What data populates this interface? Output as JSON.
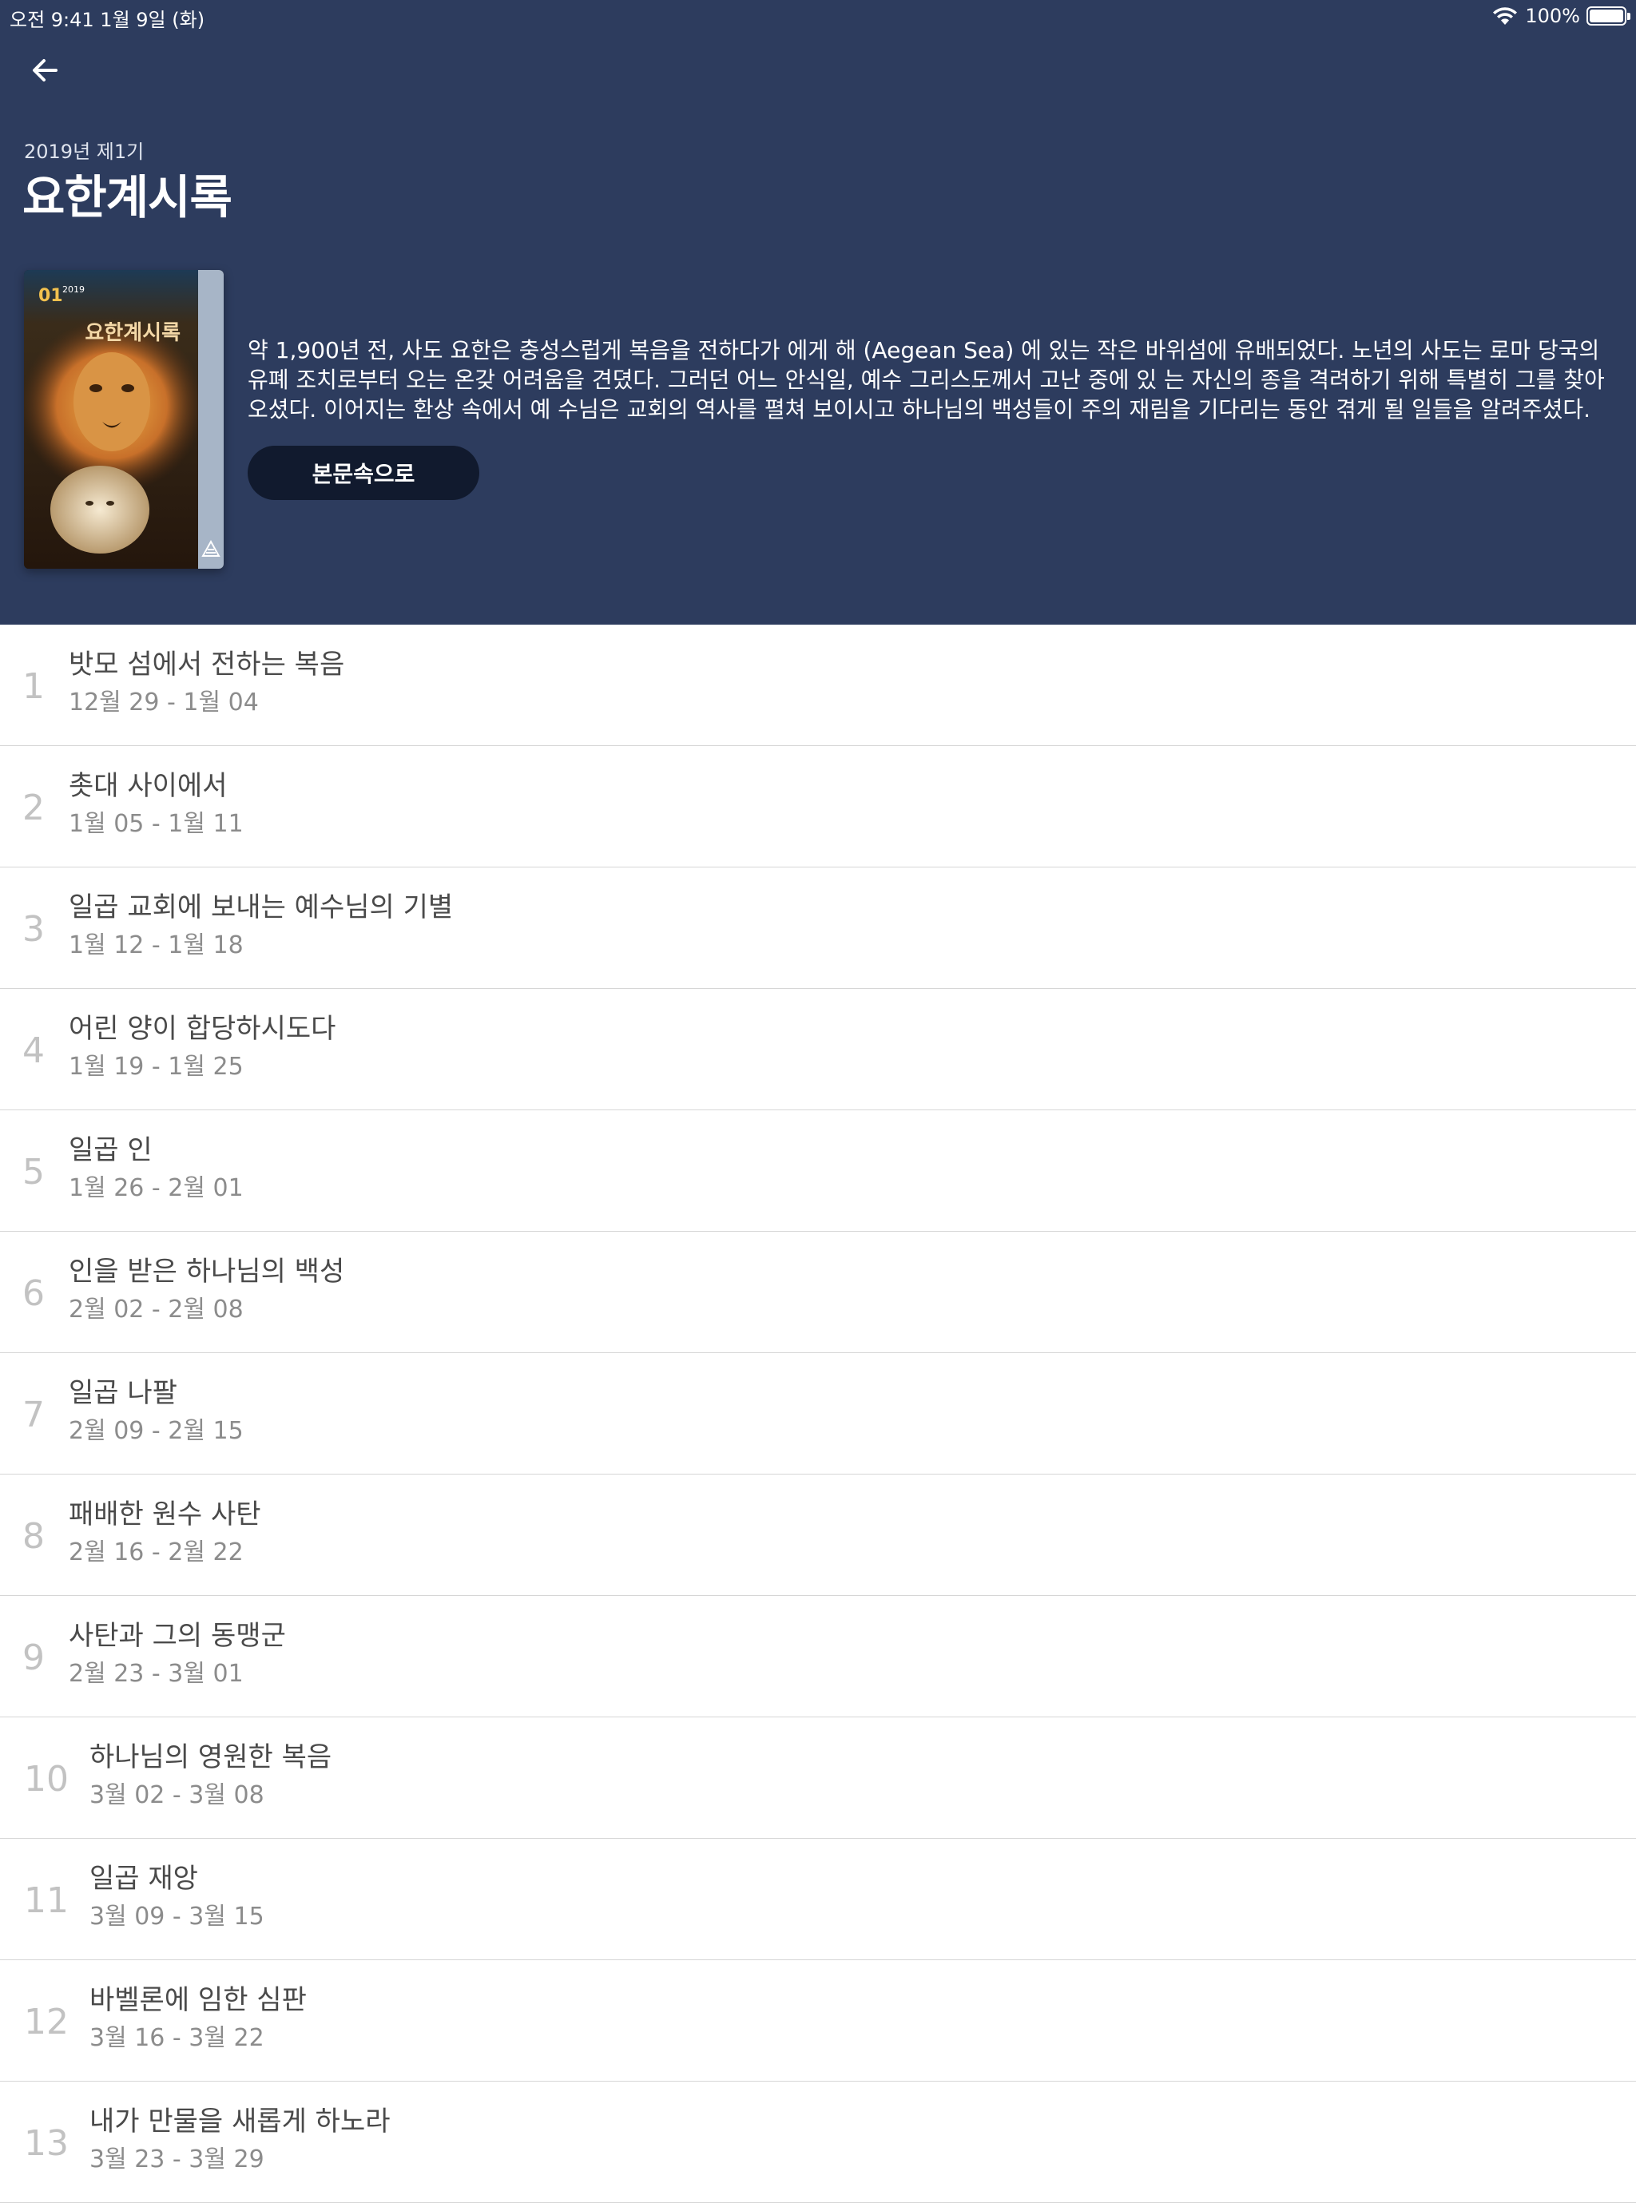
{
  "status_bar": {
    "time": "오전 9:41   1월 9일 (화)",
    "battery": "100%"
  },
  "header": {
    "quarter": "2019년 제1기",
    "title": "요한계시록",
    "description": "약 1,900년 전, 사도 요한은 충성스럽게 복음을 전하다가 에게 해 (Aegean Sea) 에 있는 작은 바위섬에 유배되었다. 노년의 사도는 로마 당국의 유폐 조치로부터 오는 온갖 어려움을 견뎠다. 그러던 어느 안식일, 예수 그리스도께서 고난 중에 있 는 자신의 종을 격려하기 위해 특별히 그를 찾아오셨다. 이어지는 환상 속에서 예 수님은 교회의 역사를 펼쳐 보이시고 하나님의 백성들이 주의 재림을 기다리는 동안 겪게 될 일들을 알려주셨다.",
    "start_button": "본문속으로",
    "cover": {
      "number": "01",
      "year": "2019",
      "title": "요한계시록"
    }
  },
  "lessons": [
    {
      "number": "1",
      "title": "밧모 섬에서 전하는 복음",
      "dates": "12월 29 - 1월 04"
    },
    {
      "number": "2",
      "title": "촛대 사이에서",
      "dates": "1월 05 - 1월 11"
    },
    {
      "number": "3",
      "title": "일곱 교회에 보내는 예수님의 기별",
      "dates": "1월 12 - 1월 18"
    },
    {
      "number": "4",
      "title": "어린 양이 합당하시도다",
      "dates": "1월 19 - 1월 25"
    },
    {
      "number": "5",
      "title": "일곱 인",
      "dates": "1월 26 - 2월 01"
    },
    {
      "number": "6",
      "title": "인을 받은 하나님의 백성",
      "dates": "2월 02 - 2월 08"
    },
    {
      "number": "7",
      "title": "일곱 나팔",
      "dates": "2월 09 - 2월 15"
    },
    {
      "number": "8",
      "title": "패배한 원수 사탄",
      "dates": "2월 16 - 2월 22"
    },
    {
      "number": "9",
      "title": "사탄과 그의 동맹군",
      "dates": "2월 23 - 3월 01"
    },
    {
      "number": "10",
      "title": "하나님의 영원한 복음",
      "dates": "3월 02 - 3월 08"
    },
    {
      "number": "11",
      "title": "일곱 재앙",
      "dates": "3월 09 - 3월 15"
    },
    {
      "number": "12",
      "title": "바벨론에 임한 심판",
      "dates": "3월 16 - 3월 22"
    },
    {
      "number": "13",
      "title": "내가 만물을 새롭게 하노라",
      "dates": "3월 23 - 3월 29"
    }
  ]
}
